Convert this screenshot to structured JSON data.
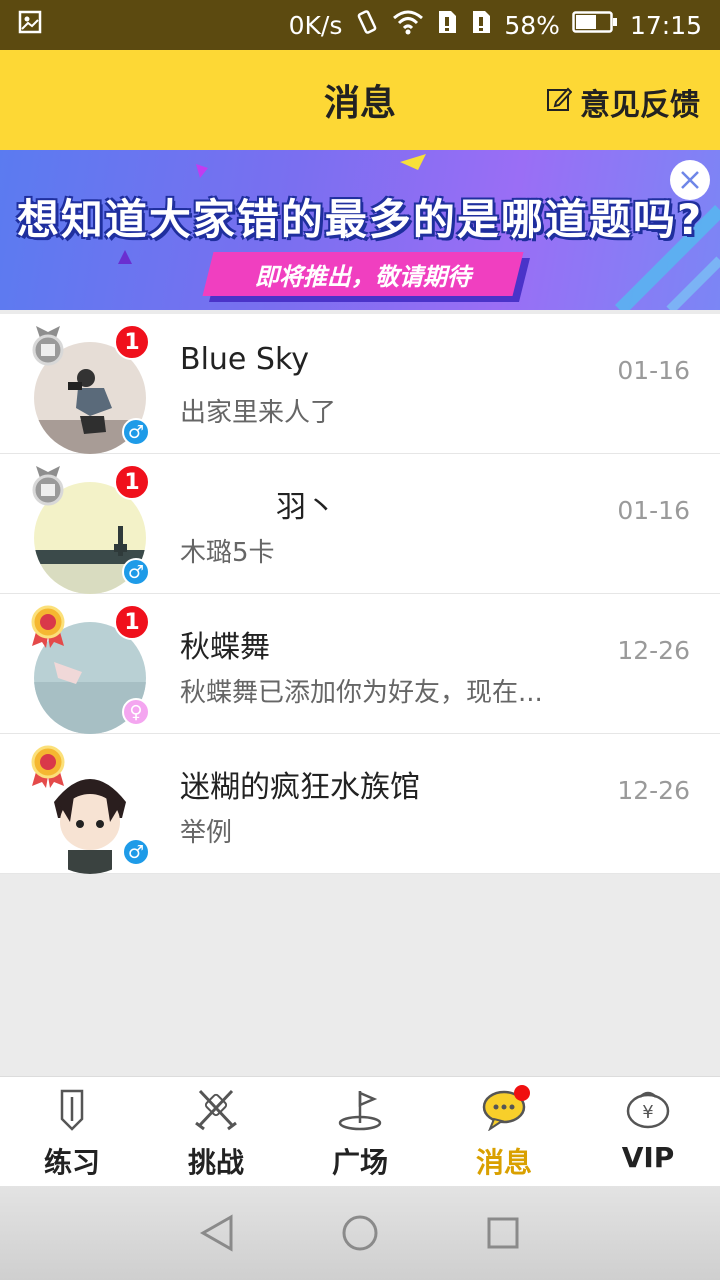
{
  "status_bar": {
    "speed": "0K/s",
    "battery": "58%",
    "time": "17:15"
  },
  "header": {
    "title": "消息",
    "feedback_label": "意见反馈"
  },
  "banner": {
    "headline": "想知道大家错的最多的是哪道题吗?",
    "subline": "即将推出，敬请期待"
  },
  "conversations": [
    {
      "name": "Blue Sky",
      "message": "出家里来人了",
      "time": "01-16",
      "unread": "1",
      "gender": "male",
      "medal": "silver"
    },
    {
      "name": "羽丶",
      "message": "木璐5卡",
      "time": "01-16",
      "unread": "1",
      "gender": "male",
      "medal": "silver"
    },
    {
      "name": "秋蝶舞",
      "message": "秋蝶舞已添加你为好友，现在...",
      "time": "12-26",
      "unread": "1",
      "gender": "female",
      "medal": "gold"
    },
    {
      "name": "迷糊的疯狂水族馆",
      "message": "举例",
      "time": "12-26",
      "unread": "",
      "gender": "male",
      "medal": "gold"
    }
  ],
  "bottom_nav": [
    {
      "label": "练习",
      "icon": "pencil-icon"
    },
    {
      "label": "挑战",
      "icon": "crossed-swords-icon"
    },
    {
      "label": "广场",
      "icon": "golf-flag-icon"
    },
    {
      "label": "消息",
      "icon": "chat-bubble-icon"
    },
    {
      "label": "VIP",
      "icon": "yen-coin-icon"
    }
  ],
  "colors": {
    "header_bg": "#fdd835",
    "active_tab": "#d9a000",
    "unread_badge": "#f0101c",
    "male": "#1e9be8",
    "female": "#f4a6f0"
  }
}
